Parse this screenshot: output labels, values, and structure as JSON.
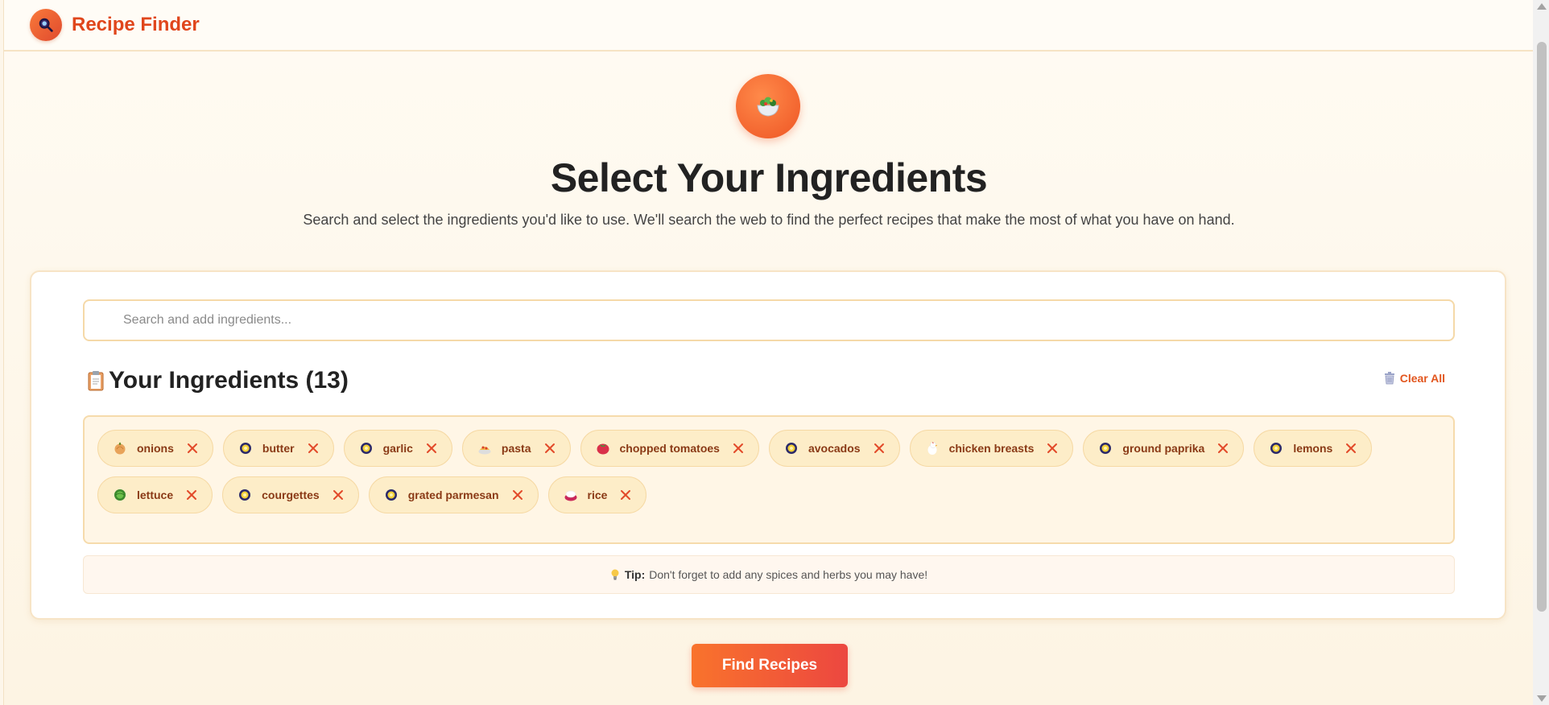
{
  "header": {
    "brand": "Recipe Finder",
    "logo_icon": "search-icon"
  },
  "hero": {
    "icon": "salad-bowl-icon",
    "title": "Select Your Ingredients",
    "subtitle": "Search and select the ingredients you'd like to use. We'll search the web to find the perfect recipes that make the most of what you have on hand."
  },
  "search": {
    "placeholder": "Search and add ingredients...",
    "value": ""
  },
  "ingredients_section": {
    "icon": "clipboard-icon",
    "title": "Your Ingredients (13)",
    "clear_all_label": "Clear All",
    "clear_all_icon": "trash-icon"
  },
  "ingredients": [
    {
      "label": "onions",
      "icon": "onion-icon"
    },
    {
      "label": "butter",
      "icon": "generic-food-icon"
    },
    {
      "label": "garlic",
      "icon": "generic-food-icon"
    },
    {
      "label": "pasta",
      "icon": "spaghetti-icon"
    },
    {
      "label": "chopped tomatoes",
      "icon": "tomato-icon"
    },
    {
      "label": "avocados",
      "icon": "generic-food-icon"
    },
    {
      "label": "chicken breasts",
      "icon": "chicken-icon"
    },
    {
      "label": "ground paprika",
      "icon": "generic-food-icon"
    },
    {
      "label": "lemons",
      "icon": "generic-food-icon"
    },
    {
      "label": "lettuce",
      "icon": "lettuce-icon"
    },
    {
      "label": "courgettes",
      "icon": "generic-food-icon"
    },
    {
      "label": "grated parmesan",
      "icon": "generic-food-icon"
    },
    {
      "label": "rice",
      "icon": "rice-icon"
    }
  ],
  "tip": {
    "icon": "lightbulb-icon",
    "label": "Tip:",
    "text": "Don't forget to add any spices and herbs you may have!"
  },
  "actions": {
    "find_recipes_label": "Find Recipes"
  },
  "colors": {
    "accent": "#e0461c",
    "chip_bg": "#fdedc8",
    "chip_text": "#8a3a16",
    "button_start": "#f9732c",
    "button_end": "#ec4740"
  }
}
